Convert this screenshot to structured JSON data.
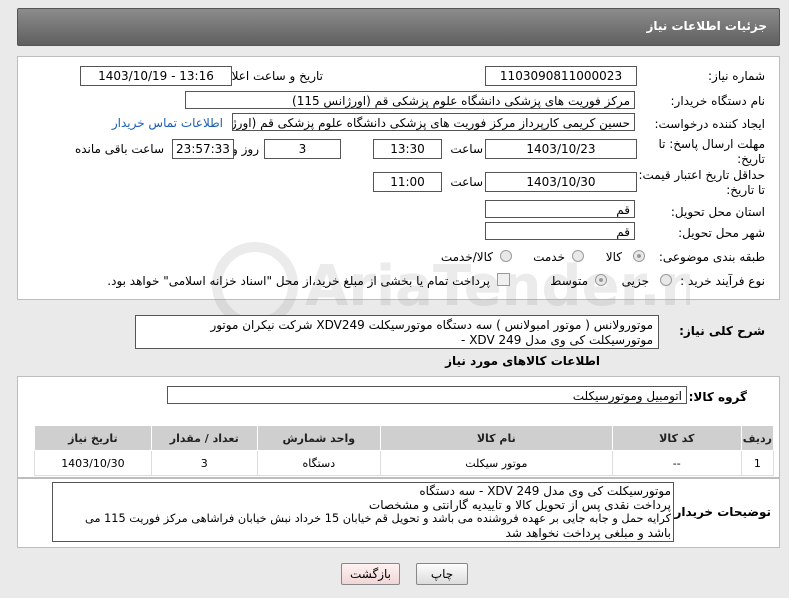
{
  "header": {
    "title": "جزئیات اطلاعات نیاز"
  },
  "form": {
    "need_number_label": "شماره نیاز:",
    "need_number": "1103090811000023",
    "announce_label": "تاریخ و ساعت اعلان عمومی:",
    "announce_value": "1403/10/19 - 13:16",
    "buyer_label": "نام دستگاه خریدار:",
    "buyer_value": "مرکز فوریت های پزشکی دانشگاه علوم پزشکی قم (اورژانس 115)",
    "creator_label": "ایجاد کننده درخواست:",
    "creator_value": "حسین کریمی کارپرداز مرکز فوریت های پزشکی دانشگاه علوم پزشکی قم (اورژانس 115)",
    "contact_link": "اطلاعات تماس خریدار",
    "deadline_label": "مهلت ارسال پاسخ: تا تاریخ:",
    "deadline_date": "1403/10/23",
    "time_label": "ساعت",
    "deadline_time": "13:30",
    "days_value": "3",
    "days_label": "روز و",
    "remaining_value": "23:57:33",
    "remaining_label": "ساعت باقی مانده",
    "validity_label": "حداقل تاریخ اعتبار قیمت: تا تاریخ:",
    "validity_date": "1403/10/30",
    "validity_time_label": "ساعت",
    "validity_time": "11:00",
    "province_label": "استان محل تحویل:",
    "province_value": "قم",
    "city_label": "شهر محل تحویل:",
    "city_value": "قم",
    "category_label": "طبقه بندی موضوعی:",
    "category_options": [
      "کالا",
      "خدمت",
      "کالا/خدمت"
    ],
    "process_label": "نوع فرآیند خرید :",
    "process_options": [
      "جزیی",
      "متوسط"
    ],
    "payment_note": "پرداخت تمام یا بخشی از مبلغ خرید،از محل \"اسناد خزانه اسلامی\" خواهد بود."
  },
  "description": {
    "label": "شرح کلی نیاز:",
    "text_line1": "موتورولانس ( موتور امبولانس ) سه دستگاه موتورسیکلت XDV249   شرکت نیکران موتور",
    "text_line2": "موتورسیکلت کی وی مدل XDV 249 -"
  },
  "goods": {
    "section_title": "اطلاعات کالاهای مورد نیاز",
    "group_label": "گروه کالا:",
    "group_value": "اتومبیل وموتورسیکلت",
    "columns": [
      "ردیف",
      "کد کالا",
      "نام کالا",
      "واحد شمارش",
      "تعداد / مقدار",
      "تاریخ نیاز"
    ],
    "rows": [
      {
        "row": "1",
        "code": "--",
        "name": "موتور سیکلت",
        "unit": "دستگاه",
        "qty": "3",
        "date": "1403/10/30"
      }
    ]
  },
  "buyer_notes": {
    "label": "توضیحات خریدار:",
    "lines": [
      "موتورسیکلت کی وی مدل XDV 249 -  سه دستگاه",
      "پرداخت نقدی پس از تحویل کالا و تاییدیه گارانتی و مشخصات",
      "کرایه حمل و جابه جایی بر عهده فروشنده می باشد و تحویل قم خیابان 15 خرداد نبش خیابان فراشاهی مرکز فوریت 115 می",
      "باشد و مبلغی پرداخت نخواهد شد"
    ]
  },
  "buttons": {
    "print": "چاپ",
    "back": "بازگشت"
  },
  "watermark": {
    "text": "AriaTender.net"
  },
  "colors": {
    "header": "#6e6e6e",
    "link": "#1a5fb4",
    "back_button": "#f7dede"
  }
}
